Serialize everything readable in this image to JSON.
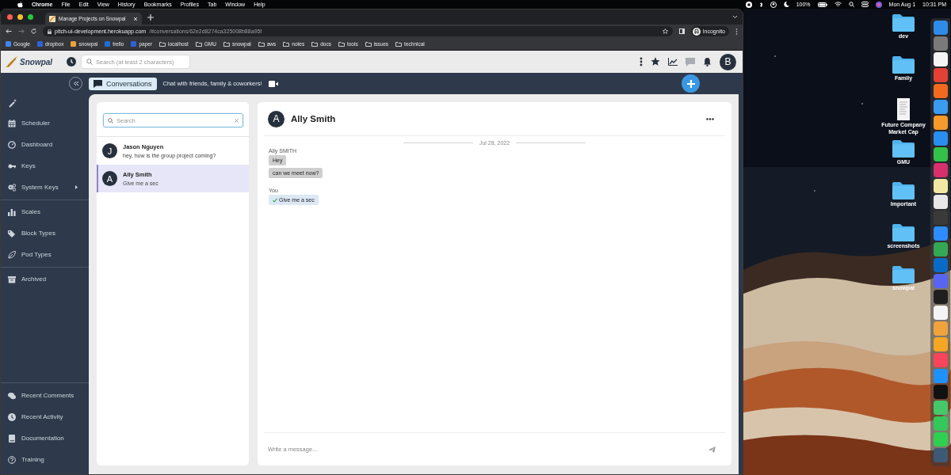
{
  "menu_bar": {
    "app": "Chrome",
    "menus": [
      "File",
      "Edit",
      "View",
      "History",
      "Bookmarks",
      "Profiles",
      "Tab",
      "Window",
      "Help"
    ],
    "battery": "100%",
    "date": "Mon Aug 1",
    "time": "10:31 PM"
  },
  "browser": {
    "tab": {
      "title": "Manage Projects on Snowpal",
      "selected": true
    },
    "address": {
      "host": "pitch-ui-development.herokuapp.com",
      "path": "/#conversations/62e2d8274ca325008b88a95f"
    },
    "profile": "Incognito",
    "bookmarks": [
      {
        "label": "Google",
        "kind": "site",
        "color": "#4285f4"
      },
      {
        "label": "dropbox",
        "kind": "site",
        "color": "#2f62d9"
      },
      {
        "label": "snowpal",
        "kind": "site",
        "color": "#e8a33c"
      },
      {
        "label": "trello",
        "kind": "site",
        "color": "#1d6fd6"
      },
      {
        "label": "paper",
        "kind": "site",
        "color": "#2f62d9"
      },
      {
        "label": "localhost",
        "kind": "folder"
      },
      {
        "label": "GMU",
        "kind": "folder"
      },
      {
        "label": "snowpal",
        "kind": "folder"
      },
      {
        "label": "aws",
        "kind": "folder"
      },
      {
        "label": "notes",
        "kind": "folder"
      },
      {
        "label": "docs",
        "kind": "folder"
      },
      {
        "label": "tools",
        "kind": "folder"
      },
      {
        "label": "issues",
        "kind": "folder"
      },
      {
        "label": "technical",
        "kind": "folder"
      }
    ]
  },
  "app": {
    "logo": "Snowpal",
    "search": {
      "placeholder": "Search (at least 2 characters)"
    },
    "avatar": "B",
    "page_tab": {
      "label": "Conversations",
      "selected": true
    },
    "tagline": "Chat with friends, family & coworkers!",
    "sidebar": {
      "groups": [
        {
          "items": [
            {
              "label": "Scheduler",
              "submenu": false
            },
            {
              "label": "Dashboard",
              "submenu": false
            },
            {
              "label": "Keys",
              "submenu": false
            },
            {
              "label": "System Keys",
              "submenu": true
            }
          ]
        },
        {
          "items": [
            {
              "label": "Scales",
              "submenu": false
            },
            {
              "label": "Block Types",
              "submenu": false
            },
            {
              "label": "Pod Types",
              "submenu": false
            }
          ]
        },
        {
          "items": [
            {
              "label": "Archived",
              "submenu": false
            }
          ]
        }
      ],
      "footer": [
        {
          "label": "Recent Comments"
        },
        {
          "label": "Recent Activity"
        },
        {
          "label": "Documentation"
        },
        {
          "label": "Training"
        }
      ]
    },
    "conversations": {
      "search": {
        "placeholder": "Search"
      },
      "items": [
        {
          "initial": "J",
          "name": "Jason Nguyen",
          "preview": "hey, how is the group project coming?",
          "selected": false
        },
        {
          "initial": "A",
          "name": "Ally Smith",
          "preview": "Give me a sec",
          "selected": true
        }
      ]
    },
    "chat": {
      "initial": "A",
      "name": "Ally Smith",
      "date": "Jul 28, 2022",
      "groups": [
        {
          "sender": "Ally SMITH",
          "mine": false,
          "messages": [
            {
              "text": "Hey",
              "read": false
            },
            {
              "text": "can we meet now?",
              "read": false
            }
          ]
        },
        {
          "sender": "You",
          "mine": true,
          "messages": [
            {
              "text": "Give me a sec",
              "read": true
            }
          ]
        }
      ],
      "composer": {
        "placeholder": "Write a message..."
      }
    }
  },
  "desktop": {
    "icons": [
      {
        "label": "dev",
        "kind": "folder"
      },
      {
        "label": "Family",
        "kind": "folder"
      },
      {
        "label": "Future Company Market Cap",
        "kind": "document"
      },
      {
        "label": "GMU",
        "kind": "folder"
      },
      {
        "label": "Important",
        "kind": "folder"
      },
      {
        "label": "screenshots",
        "kind": "folder"
      },
      {
        "label": "snowpal",
        "kind": "folder"
      }
    ],
    "dock": [
      {
        "color": "#2f8be8"
      },
      {
        "color": "#7a7a7a"
      },
      {
        "color": "#f5f5f5"
      },
      {
        "color": "#e34133"
      },
      {
        "color": "#f36a1f"
      },
      {
        "color": "#3a9bf0"
      },
      {
        "color": "#f79a2c"
      },
      {
        "color": "#2a8ef0"
      },
      {
        "color": "#34c14a"
      },
      {
        "color": "#d8306d"
      },
      {
        "color": "#f3e7a4"
      },
      {
        "color": "#e8e8e8"
      },
      {
        "color": "#3a3a3a"
      },
      {
        "color": "#2d8cff"
      },
      {
        "color": "#34a853"
      },
      {
        "color": "#0a6bc7"
      },
      {
        "color": "#5865f2"
      },
      {
        "color": "#1f1f1f"
      },
      {
        "color": "#f4f4f4"
      },
      {
        "color": "#f0a33c"
      },
      {
        "color": "#f5a623"
      },
      {
        "color": "#f9445b"
      },
      {
        "color": "#1e90ff"
      },
      {
        "color": "#111111"
      },
      {
        "color": "#44c86a"
      },
      {
        "color": "#34c759"
      },
      {
        "color": "#2fcf4f"
      },
      {
        "color": "#3c5a75"
      }
    ]
  }
}
